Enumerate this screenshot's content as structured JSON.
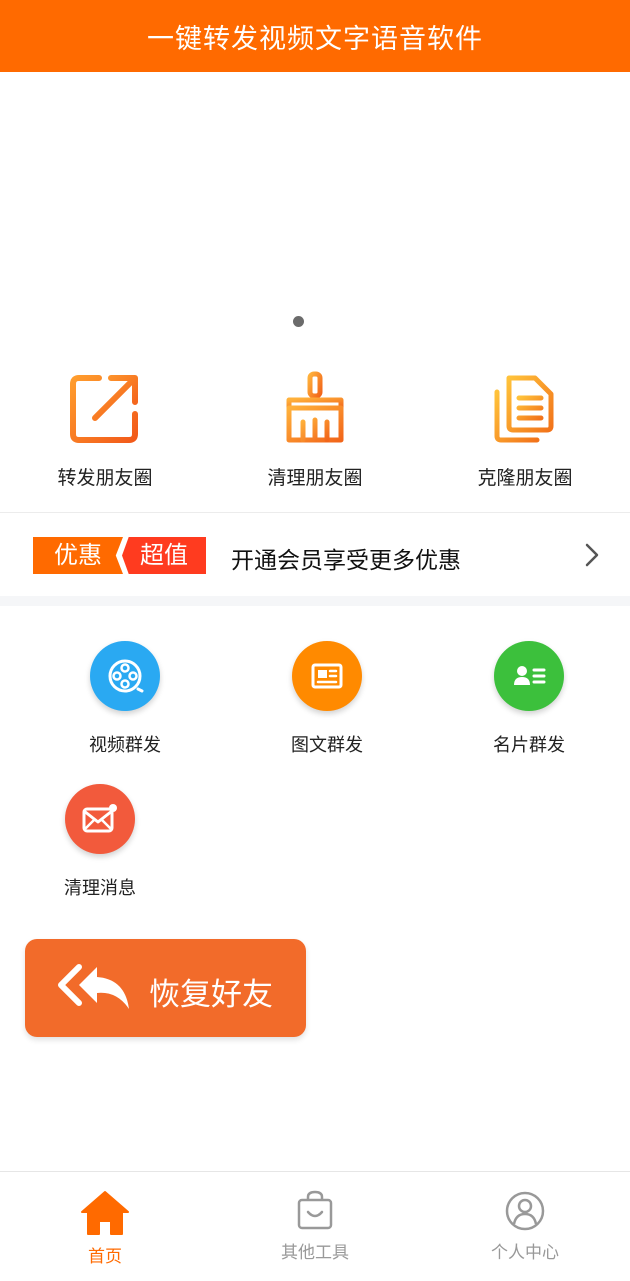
{
  "header": {
    "title": "一键转发视频文字语音软件"
  },
  "top_actions": [
    {
      "label": "转发朋友圈",
      "icon": "share-out-icon"
    },
    {
      "label": "清理朋友圈",
      "icon": "broom-icon"
    },
    {
      "label": "克隆朋友圈",
      "icon": "copy-documents-icon"
    }
  ],
  "promo": {
    "tag1": "优惠",
    "tag2": "超值",
    "text": "开通会员享受更多优惠"
  },
  "tools": [
    {
      "label": "视频群发",
      "icon": "film-reel-icon",
      "color": "#2aa9f2"
    },
    {
      "label": "图文群发",
      "icon": "newspaper-icon",
      "color": "#ff8a00"
    },
    {
      "label": "名片群发",
      "icon": "contact-card-icon",
      "color": "#3cc03c"
    },
    {
      "label": "清理消息",
      "icon": "mail-clean-icon",
      "color": "#f25a3c"
    }
  ],
  "restore": {
    "label": "恢复好友",
    "icon": "reply-all-icon"
  },
  "tabbar": {
    "active_color": "#ff6a00",
    "inactive_color": "#999999",
    "tabs": [
      {
        "label": "首页",
        "icon": "home-icon",
        "active": true
      },
      {
        "label": "其他工具",
        "icon": "bag-icon",
        "active": false
      },
      {
        "label": "个人中心",
        "icon": "user-circle-icon",
        "active": false
      }
    ]
  }
}
